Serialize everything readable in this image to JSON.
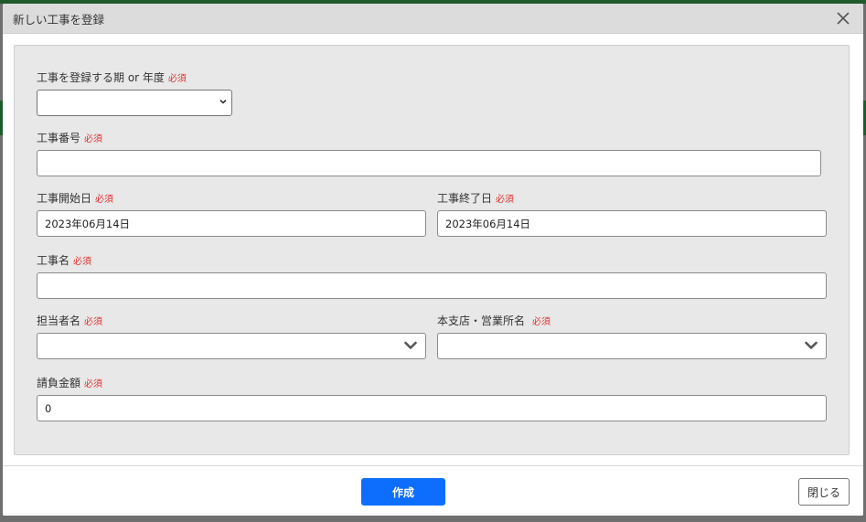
{
  "dialog": {
    "title": "新しい工事を登録",
    "close_icon": "close-icon"
  },
  "form": {
    "required_badge": "必須",
    "period": {
      "label": "工事を登録する期 or 年度",
      "value": ""
    },
    "project_number": {
      "label": "工事番号",
      "value": ""
    },
    "start_date": {
      "label": "工事開始日",
      "value": "2023年06月14日"
    },
    "end_date": {
      "label": "工事終了日",
      "value": "2023年06月14日"
    },
    "project_name": {
      "label": "工事名",
      "value": ""
    },
    "person_in_charge": {
      "label": "担当者名",
      "value": ""
    },
    "branch_office": {
      "label": "本支店・営業所名",
      "value": ""
    },
    "contract_amount": {
      "label": "請負金額",
      "value": "0"
    }
  },
  "footer": {
    "create_label": "作成",
    "close_label": "閉じる"
  },
  "colors": {
    "primary": "#0d6efd",
    "required": "#e03131",
    "header_bg": "#dcdcdc",
    "panel_bg": "#e8e8e8",
    "app_green": "#1f5a2c"
  }
}
